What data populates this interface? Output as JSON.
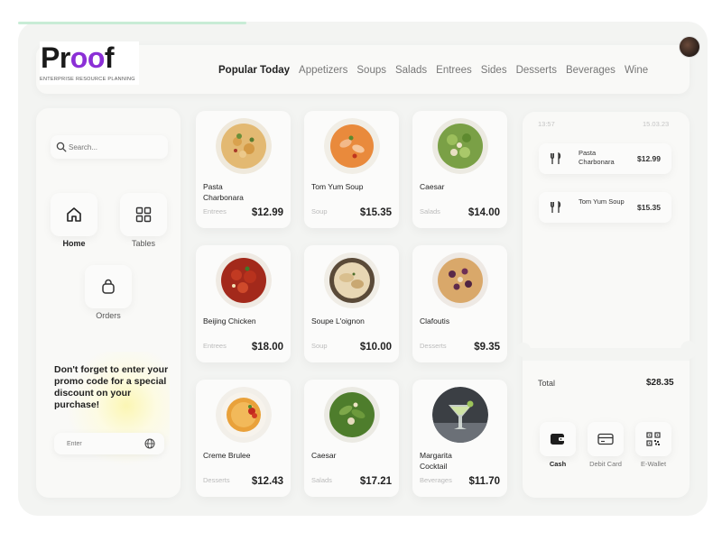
{
  "brand": {
    "logo_text_start": "Pr",
    "logo_text_oo": "oo",
    "logo_text_end": "f",
    "tagline": "ENTERPRISE RESOURCE PLANNING"
  },
  "nav": [
    "Popular Today",
    "Appetizers",
    "Soups",
    "Salads",
    "Entrees",
    "Sides",
    "Desserts",
    "Beverages",
    "Wine"
  ],
  "sidebar": {
    "search_placeholder": "Search...",
    "items": [
      {
        "label": "Home",
        "icon": "home-icon",
        "active": true
      },
      {
        "label": "Tables",
        "icon": "grid-icon",
        "active": false
      },
      {
        "label": "Orders",
        "icon": "bag-icon",
        "active": false
      }
    ],
    "promo": {
      "text": "Don't forget to enter your promo code for a special discount on your purchase!",
      "input_placeholder": "Enter"
    }
  },
  "products": [
    {
      "name": "Pasta Charbonara",
      "category": "Entrees",
      "price": "$12.99",
      "icon": "pasta-dish-icon"
    },
    {
      "name": "Tom Yum Soup",
      "category": "Soup",
      "price": "$15.35",
      "icon": "tom-yum-dish-icon"
    },
    {
      "name": "Caesar",
      "category": "Salads",
      "price": "$14.00",
      "icon": "salad-dish-icon"
    },
    {
      "name": "Beijing Chicken",
      "category": "Entrees",
      "price": "$18.00",
      "icon": "chicken-dish-icon"
    },
    {
      "name": "Soupe L'oignon",
      "category": "Soup",
      "price": "$10.00",
      "icon": "onion-soup-dish-icon"
    },
    {
      "name": "Clafoutis",
      "category": "Desserts",
      "price": "$9.35",
      "icon": "clafoutis-dish-icon"
    },
    {
      "name": "Creme Brulee",
      "category": "Desserts",
      "price": "$12.43",
      "icon": "creme-brulee-dish-icon"
    },
    {
      "name": "Caesar",
      "category": "Salads",
      "price": "$17.21",
      "icon": "salad-dish-icon"
    },
    {
      "name": "Margarita Cocktail",
      "category": "Beverages",
      "price": "$11.70",
      "icon": "cocktail-dish-icon"
    }
  ],
  "order": {
    "time": "13:57",
    "date": "15.03.23",
    "items": [
      {
        "name": "Pasta Charbonara",
        "price": "$12.99",
        "icon": "cutlery-icon"
      },
      {
        "name": "Tom Yum Soup",
        "price": "$15.35",
        "icon": "cutlery-icon"
      }
    ],
    "total_label": "Total",
    "total": "$28.35",
    "payment_methods": [
      {
        "label": "Cash",
        "icon": "wallet-icon",
        "active": true
      },
      {
        "label": "Debit Card",
        "icon": "card-icon",
        "active": false
      },
      {
        "label": "E-Wallet",
        "icon": "qr-code-icon",
        "active": false
      }
    ]
  },
  "colors": {
    "accent": "#8b2fd6",
    "background": "#f3f4f2",
    "panel": "#f9f9f7",
    "progress": "#c8ecd6"
  }
}
